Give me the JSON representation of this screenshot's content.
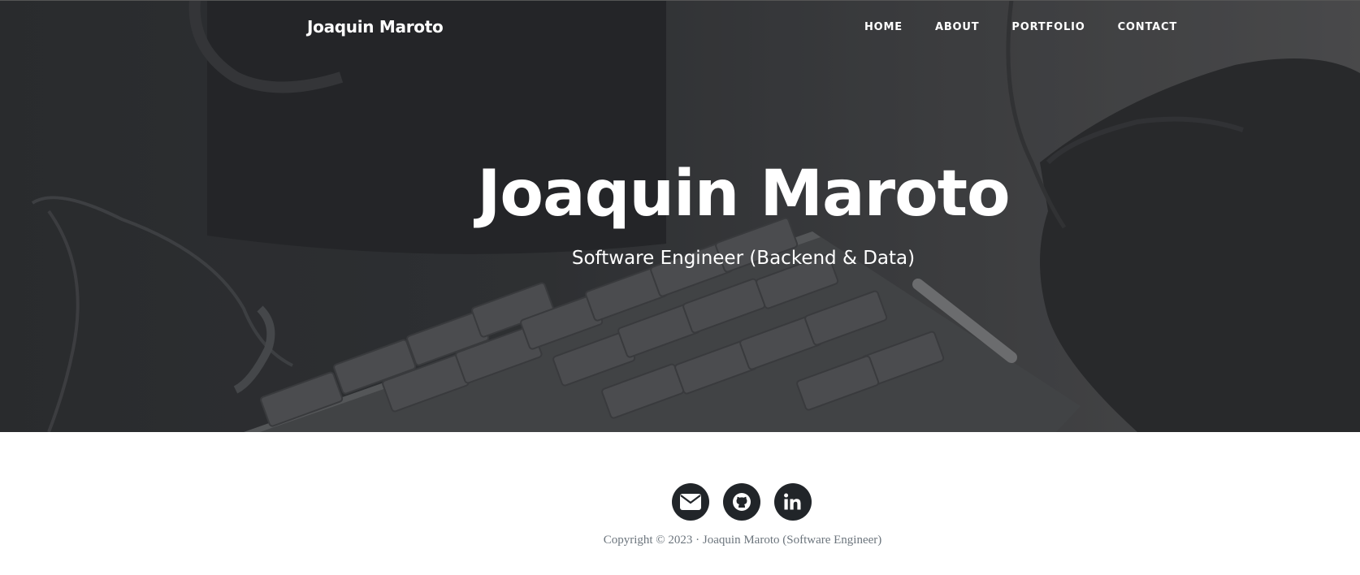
{
  "navbar": {
    "brand": "Joaquin Maroto",
    "links": [
      "HOME",
      "ABOUT",
      "PORTFOLIO",
      "CONTACT"
    ]
  },
  "hero": {
    "title": "Joaquin Maroto",
    "subtitle": "Software Engineer (Backend & Data)",
    "background_image": "desk-keyboard-mug-photo"
  },
  "footer": {
    "social": [
      {
        "icon": "envelope-icon"
      },
      {
        "icon": "github-icon"
      },
      {
        "icon": "linkedin-icon"
      }
    ],
    "copyright": "Copyright © 2023 · Joaquin Maroto (Software Engineer)"
  },
  "colors": {
    "social_bg": "#212529",
    "copyright_text": "#6c757d",
    "hero_text": "#ffffff"
  }
}
